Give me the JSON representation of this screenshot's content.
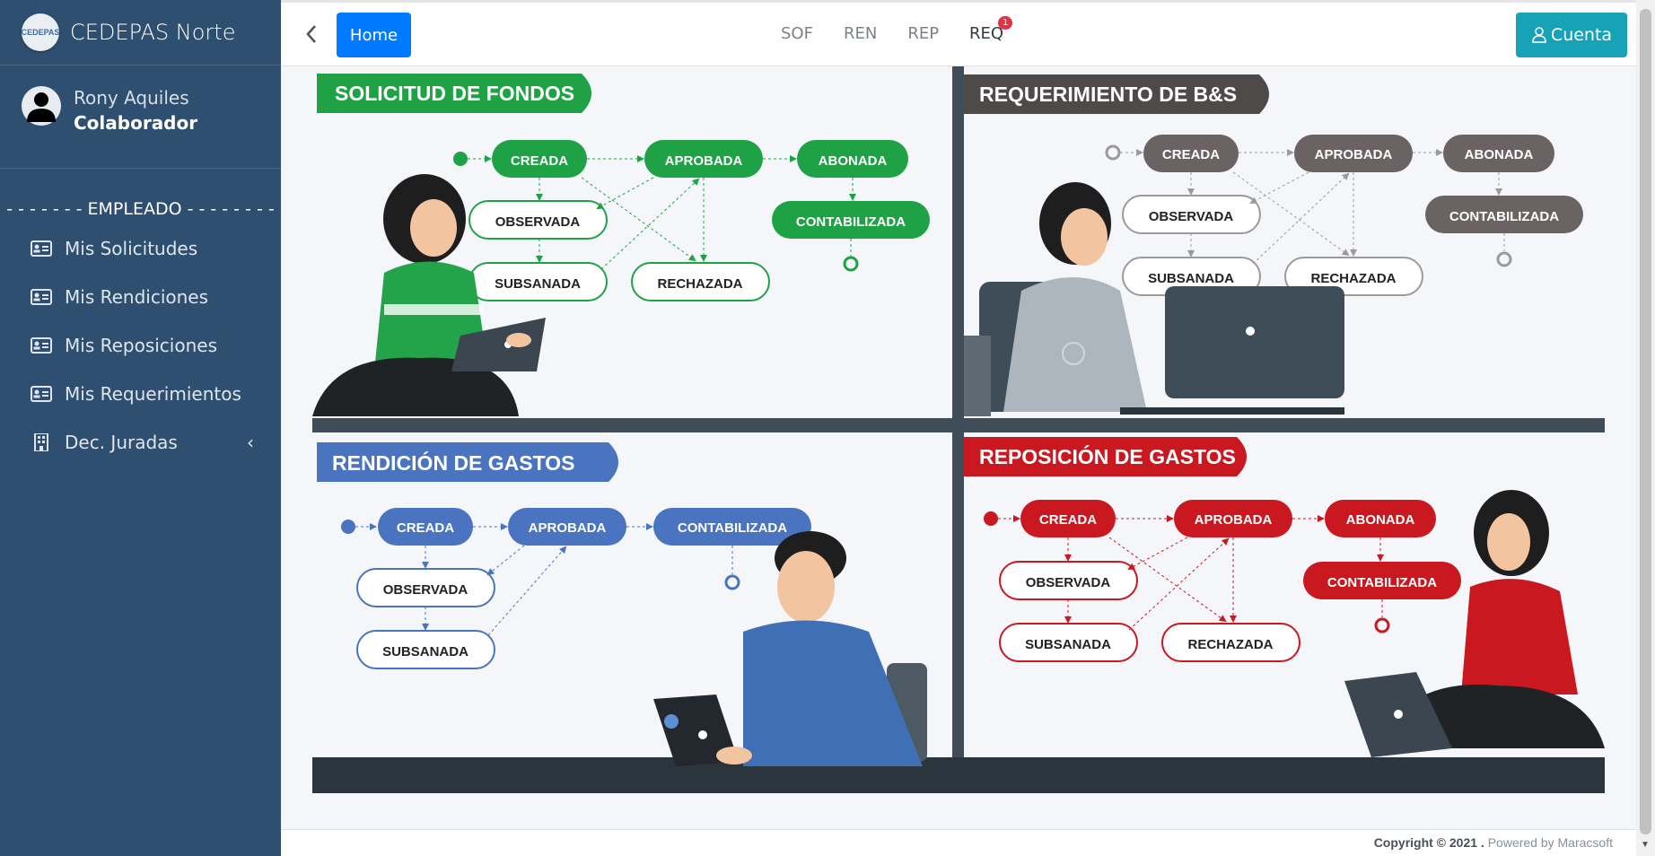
{
  "app": {
    "brand": "CEDEPAS Norte",
    "logo_text": "CEDEPAS"
  },
  "user": {
    "name": "Rony Aquiles",
    "role": "Colaborador"
  },
  "sidebar": {
    "header": "- - - - - - - EMPLEADO - - - - - - - -",
    "items": [
      {
        "label": "Mis Solicitudes",
        "icon": "id-card-icon"
      },
      {
        "label": "Mis Rendiciones",
        "icon": "id-card-icon"
      },
      {
        "label": "Mis Reposiciones",
        "icon": "id-card-icon"
      },
      {
        "label": "Mis Requerimientos",
        "icon": "id-card-icon"
      },
      {
        "label": "Dec. Juradas",
        "icon": "building-icon"
      }
    ]
  },
  "topbar": {
    "home_label": "Home",
    "links": [
      "SOF",
      "REN",
      "REP",
      "REQ"
    ],
    "req_badge": "1",
    "account_label": "Cuenta"
  },
  "panels": {
    "sof": {
      "title": "SOLICITUD DE FONDOS",
      "color": "#1fa146",
      "states": [
        "CREADA",
        "APROBADA",
        "ABONADA",
        "OBSERVADA",
        "SUBSANADA",
        "RECHAZADA",
        "CONTABILIZADA"
      ]
    },
    "req": {
      "title": "REQUERIMIENTO DE B&S",
      "color": "#6b6363",
      "states": [
        "CREADA",
        "APROBADA",
        "ABONADA",
        "OBSERVADA",
        "SUBSANADA",
        "RECHAZADA",
        "CONTABILIZADA"
      ]
    },
    "ren": {
      "title": "RENDICIÓN DE GASTOS",
      "color": "#4a74c0",
      "states": [
        "CREADA",
        "APROBADA",
        "CONTABILIZADA",
        "OBSERVADA",
        "SUBSANADA"
      ]
    },
    "rep": {
      "title": "REPOSICIÓN DE GASTOS",
      "color": "#c9181f",
      "states": [
        "CREADA",
        "APROBADA",
        "ABONADA",
        "OBSERVADA",
        "SUBSANADA",
        "RECHAZADA",
        "CONTABILIZADA"
      ]
    }
  },
  "footer": {
    "copyright": "Copyright © 2021 .",
    "powered": "Powered by Maracsoft"
  }
}
